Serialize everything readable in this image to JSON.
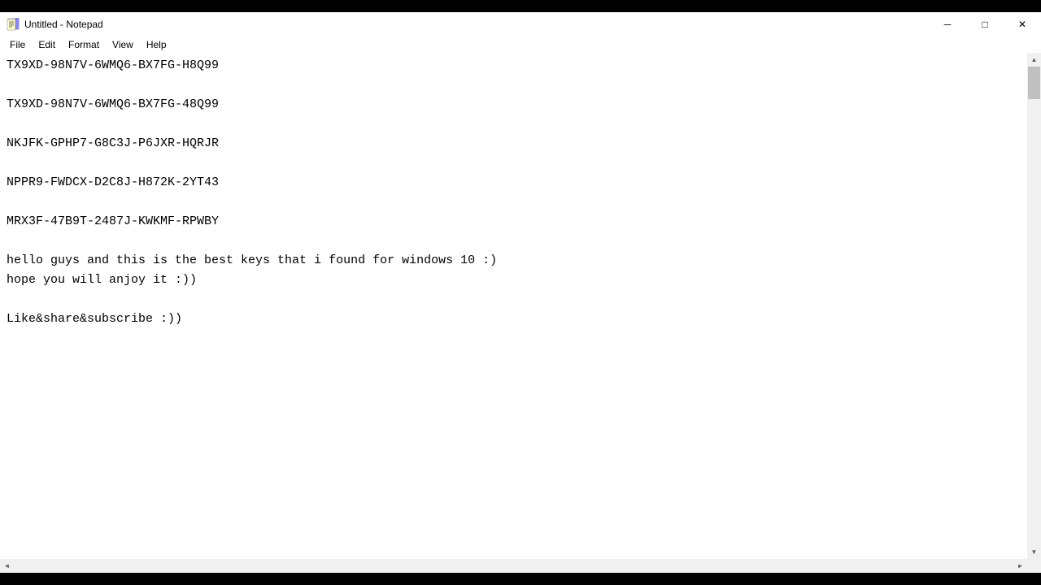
{
  "titlebar": {
    "icon": "notepad",
    "title": "Untitled - Notepad",
    "minimize_label": "─",
    "maximize_label": "□",
    "close_label": "✕"
  },
  "menubar": {
    "items": [
      "File",
      "Edit",
      "Format",
      "View",
      "Help"
    ]
  },
  "content": {
    "lines": [
      "TX9XD-98N7V-6WMQ6-BX7FG-H8Q99",
      "",
      "TX9XD-98N7V-6WMQ6-BX7FG-48Q99",
      "",
      "NKJFK-GPHP7-G8C3J-P6JXR-HQRJR",
      "",
      "NPPR9-FWDCX-D2C8J-H872K-2YT43",
      "",
      "MRX3F-47B9T-2487J-KWKMF-RPWBY",
      "",
      "hello guys and this is the best keys that i found for windows 10 :)",
      "hope you will anjoy it :))",
      "",
      "Like&share&subscribe :))"
    ]
  }
}
